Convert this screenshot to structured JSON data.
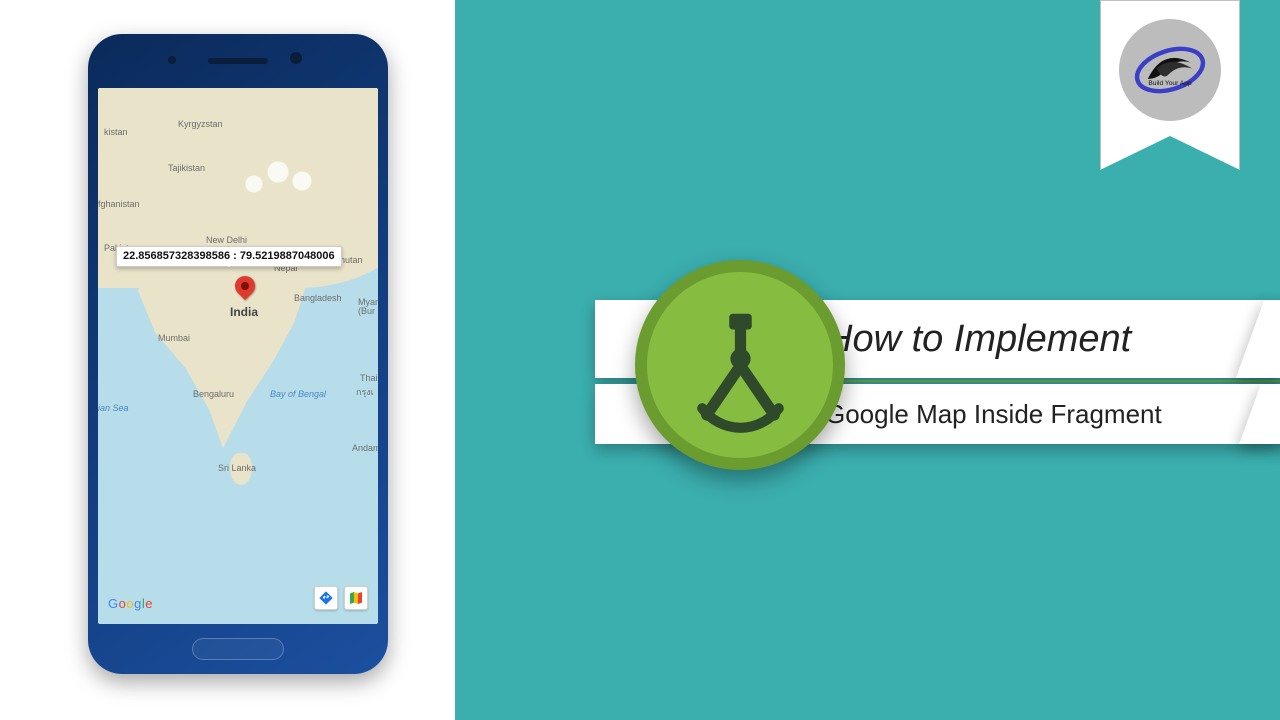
{
  "ribbon": {
    "brand_text": "Build Your App"
  },
  "title": {
    "line1": "How to Implement",
    "line2": "Google Map Inside Fragment"
  },
  "phone": {
    "coordinates_label": "22.856857328398586 : 79.5219887048006",
    "pin_country": "India",
    "google_watermark": "Google",
    "map_labels": {
      "kyrgyzstan": "Kyrgyzstan",
      "tajikistan": "Tajikistan",
      "afghanistan_frag": "fghanistan",
      "pakistan_top": "kistan",
      "pakistan": "Pakistan",
      "newdelhi": "New Delhi",
      "nepal": "Nepal",
      "bangladesh": "Bangladesh",
      "bhutan": "Bhutan",
      "myanmar_frag": "Myar\n(Bur",
      "mumbai": "Mumbai",
      "bengaluru": "Bengaluru",
      "bay": "Bay of Bengal",
      "sea": "ian Sea",
      "srilanka": "Sri Lanka",
      "andaman": "Andama",
      "thailand": "Thail",
      "bangkok": "กรุงเ"
    }
  }
}
